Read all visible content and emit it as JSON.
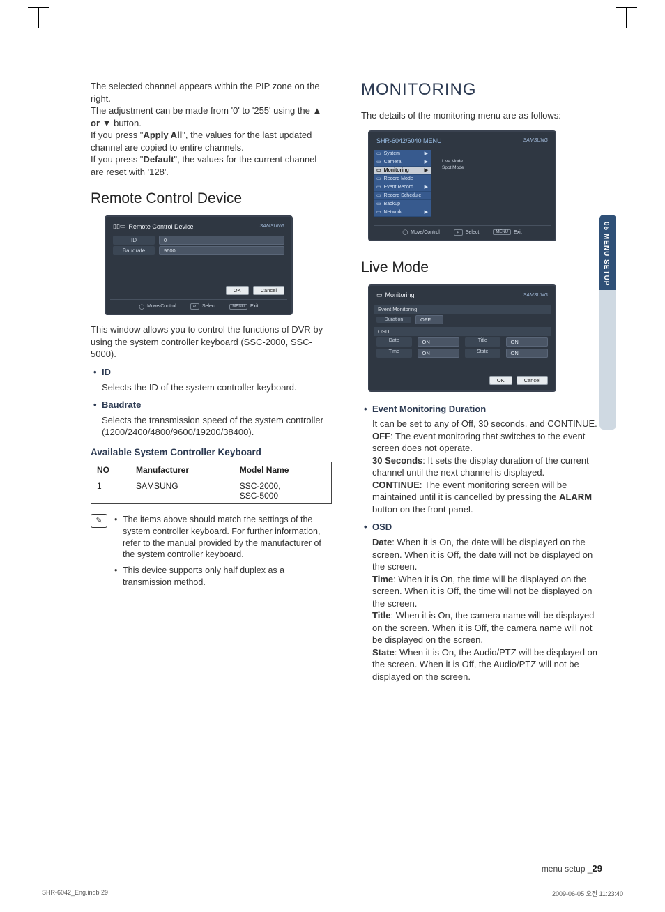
{
  "left_col": {
    "intro": {
      "p1": "The selected channel appears within the PIP zone on the right.",
      "p2_before": "The adjustment can be made from '0' to '255' using the ",
      "p2_bold": "▲ or ▼",
      "p2_after": " button.",
      "p3_before": "If you press \"",
      "p3_bold": "Apply All",
      "p3_after": "\", the values for the last updated channel are copied to entire channels.",
      "p4_before": "If you press \"",
      "p4_bold": "Default",
      "p4_after": "\", the values for the current channel are reset with '128'."
    },
    "rcd_heading": "Remote Control Device",
    "rcd_ui": {
      "title": "Remote Control Device",
      "brand": "SAMSUNG",
      "rows": [
        {
          "label": "ID",
          "value": "0"
        },
        {
          "label": "Baudrate",
          "value": "9600"
        }
      ],
      "ok": "OK",
      "cancel": "Cancel",
      "footer": {
        "move": "Move/Control",
        "select": "Select",
        "exit": "Exit",
        "exit_key": "MENU"
      }
    },
    "rcd_desc": "This window allows you to control the functions of DVR by using the system controller keyboard (SSC-2000, SSC-5000).",
    "items": [
      {
        "title": "ID",
        "desc": "Selects the ID of the system controller keyboard."
      },
      {
        "title": "Baudrate",
        "desc": "Selects the transmission speed of the system controller (1200/2400/4800/9600/19200/38400)."
      }
    ],
    "sub_heading": "Available System Controller Keyboard",
    "table": {
      "headers": [
        "NO",
        "Manufacturer",
        "Model Name"
      ],
      "row": {
        "no": "1",
        "mfr": "SAMSUNG",
        "models": [
          "SSC-2000,",
          "SSC-5000"
        ]
      }
    },
    "notes": [
      "The items above should match the settings of the system controller keyboard. For further information, refer to the manual provided by the manufacturer of the system controller keyboard.",
      "This device supports only half duplex as a transmission method."
    ]
  },
  "right_col": {
    "title": "MONITORING",
    "intro": "The details of the monitoring menu are as follows:",
    "menu_ui": {
      "title": "SHR-6042/6040 MENU",
      "brand": "SAMSUNG",
      "items": [
        "System",
        "Camera",
        "Monitoring",
        "Record Mode",
        "Event Record",
        "Record Schedule",
        "Backup",
        "Network"
      ],
      "active_index": 2,
      "submenu": [
        "Live Mode",
        "Spot Mode"
      ],
      "footer": {
        "move": "Move/Control",
        "select": "Select",
        "exit": "Exit",
        "exit_key": "MENU"
      }
    },
    "live_heading": "Live Mode",
    "live_ui": {
      "title": "Monitoring",
      "brand": "SAMSUNG",
      "section1": "Event Monitoring",
      "duration_label": "Duration",
      "duration_val": "OFF",
      "section2": "OSD",
      "osd": [
        {
          "label": "Date",
          "val": "ON"
        },
        {
          "label": "Time",
          "val": "ON"
        },
        {
          "label": "Title",
          "val": "ON"
        },
        {
          "label": "State",
          "val": "ON"
        }
      ],
      "ok": "OK",
      "cancel": "Cancel"
    },
    "bullets": [
      {
        "title": "Event Monitoring Duration",
        "lines": [
          {
            "pre": "",
            "bold": "",
            "post": "It can be set to any of Off, 30 seconds, and CONTINUE."
          },
          {
            "pre": "",
            "bold": "OFF",
            "post": ": The event monitoring that switches to the event screen does not operate."
          },
          {
            "pre": "",
            "bold": "30 Seconds",
            "post": ": It sets the display duration of the current channel until the next channel is displayed."
          },
          {
            "pre": "",
            "bold": "CONTINUE",
            "post_before": ": The event monitoring screen will be maintained until it is cancelled by pressing the ",
            "post_bold": "ALARM",
            "post_after": " button on the front panel."
          }
        ]
      },
      {
        "title": "OSD",
        "lines": [
          {
            "bold": "Date",
            "post": ": When it is On, the date will be displayed on the screen. When it is Off, the date will not be displayed on the screen."
          },
          {
            "bold": "Time",
            "post": ": When it is On, the time will be displayed on the screen. When it is Off, the time will not be displayed on the screen."
          },
          {
            "bold": "Title",
            "post": ": When it is On, the camera name will be displayed on the screen. When it is Off, the camera name will not be displayed on the screen."
          },
          {
            "bold": "State",
            "post": ": When it is On, the Audio/PTZ will be displayed on the screen. When it is Off, the Audio/PTZ will not be displayed on the screen."
          }
        ]
      }
    ]
  },
  "side_tab": "05 MENU SETUP",
  "footer": {
    "label": "menu setup _",
    "page": "29"
  },
  "print": {
    "left": "SHR-6042_Eng.indb   29",
    "right": "2009-06-05   오전 11:23:40"
  }
}
